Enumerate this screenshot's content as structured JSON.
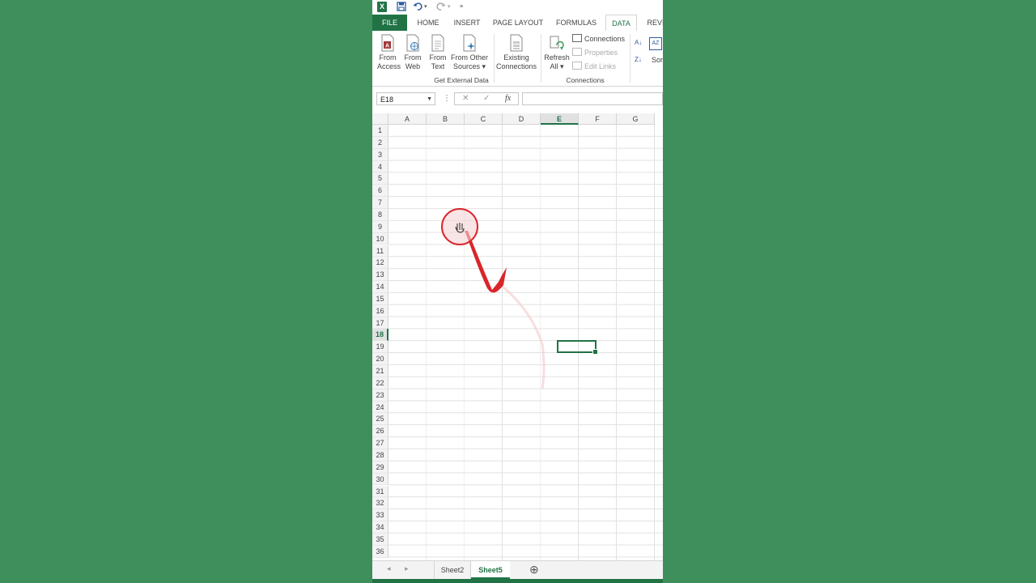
{
  "tabs": [
    "FILE",
    "HOME",
    "INSERT",
    "PAGE LAYOUT",
    "FORMULAS",
    "DATA",
    "REVIE"
  ],
  "active_tab": "DATA",
  "ribbon": {
    "get_external_data": {
      "buttons": [
        {
          "line1": "From",
          "line2": "Access"
        },
        {
          "line1": "From",
          "line2": "Web"
        },
        {
          "line1": "From",
          "line2": "Text"
        },
        {
          "line1": "From Other",
          "line2": "Sources ▾"
        }
      ],
      "label": "Get External Data"
    },
    "existing_connections": {
      "line1": "Existing",
      "line2": "Connections"
    },
    "connections": {
      "refresh": {
        "line1": "Refresh",
        "line2": "All ▾"
      },
      "items": [
        "Connections",
        "Properties",
        "Edit Links"
      ],
      "label": "Connections"
    },
    "sort_partial": "Sor"
  },
  "formula_bar": {
    "name_box": "E18",
    "cancel": "✕",
    "enter": "✓",
    "fx": "fx",
    "dots": "⋮",
    "formula": ""
  },
  "columns": [
    "A",
    "B",
    "C",
    "D",
    "E",
    "F",
    "G"
  ],
  "selected_column": "E",
  "rows": [
    "1",
    "2",
    "3",
    "4",
    "5",
    "6",
    "7",
    "8",
    "9",
    "10",
    "11",
    "12",
    "13",
    "14",
    "15",
    "16",
    "17",
    "18",
    "19",
    "20",
    "21",
    "22",
    "23",
    "24",
    "25",
    "26",
    "27",
    "28",
    "29",
    "30",
    "31",
    "32",
    "33",
    "34",
    "35",
    "36"
  ],
  "selected_row": "18",
  "sheets": [
    "Sheet2",
    "Sheet5"
  ],
  "active_sheet": "Sheet5",
  "nav": {
    "prev": "◂",
    "next": "▸",
    "add": "⊕"
  },
  "colors": {
    "excel_green": "#217346",
    "background": "#3f8f5c",
    "annotation_red": "#d9262b"
  }
}
